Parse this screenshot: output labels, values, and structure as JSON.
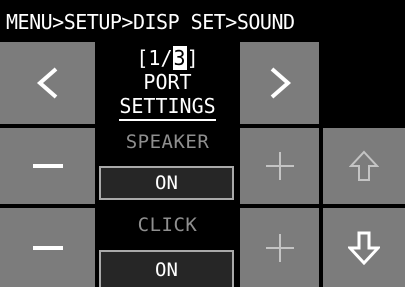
{
  "header": {
    "breadcrumb": "MENU>SETUP>DISP SET>SOUND"
  },
  "page": {
    "open": "[1/",
    "current": "3",
    "close": "]"
  },
  "title": {
    "line1": "PORT",
    "line2": "SETTINGS"
  },
  "settings": [
    {
      "label": "SPEAKER",
      "value": "ON"
    },
    {
      "label": "CLICK",
      "value": "ON"
    }
  ],
  "icons": {
    "prev": "chevron-left-icon",
    "next": "chevron-right-icon",
    "minus": "minus-icon",
    "plus": "plus-icon",
    "up": "arrow-up-outline-icon",
    "down": "arrow-down-outline-icon"
  },
  "colors": {
    "background": "#000000",
    "button": "#7c7c7c",
    "label_dim": "#8f8f8f",
    "value_box": "#262626",
    "value_border": "#a9a9a9"
  }
}
